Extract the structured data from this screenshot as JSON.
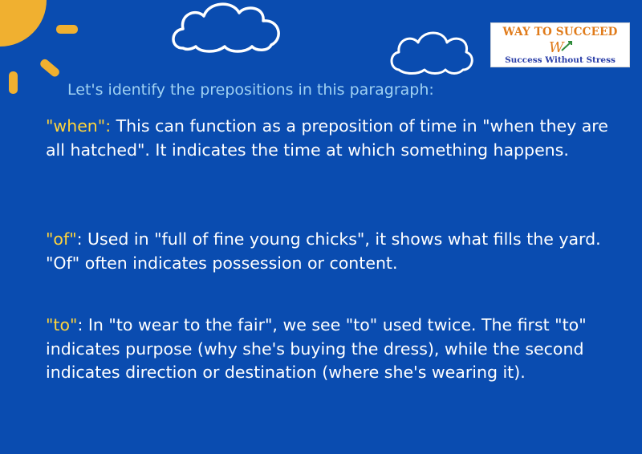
{
  "logo": {
    "line1": "WAY TO SUCCEED",
    "line2": "Success Without Stress",
    "letters": "W",
    "brand_colors": {
      "orange": "#e07b1a",
      "blue": "#2a3ea8"
    }
  },
  "intro": "Let's identify the prepositions in this paragraph:",
  "paragraphs": [
    {
      "term": "\"when\":",
      "text": " This can function as a preposition of time in \"when they are all hatched\". It indicates the time at which something happens."
    },
    {
      "term": "\"of\"",
      "text": ": Used in \"full of fine young chicks\", it shows what fills the yard. \"Of\" often indicates possession or content."
    },
    {
      "term": "\"to\"",
      "text": ": In \"to wear to the fair\", we see \"to\" used twice. The first \"to\" indicates purpose (why she's buying the dress), while the second indicates direction or destination (where she's wearing it)."
    }
  ],
  "decorations": [
    "sun-icon",
    "cloud-icon"
  ],
  "colors": {
    "background": "#0a4cb0",
    "intro_text": "#9fd1f2",
    "term": "#ffd43b",
    "body_text": "#ffffff",
    "sun": "#f0b030"
  }
}
